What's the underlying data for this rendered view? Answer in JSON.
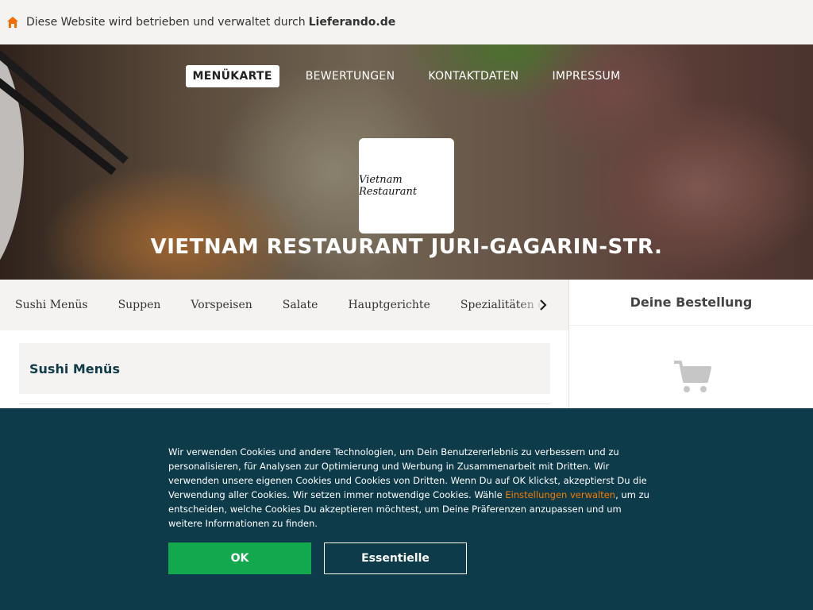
{
  "topbar": {
    "icon": "home-icon",
    "text": "Diese Website wird betrieben und verwaltet durch",
    "brand": "Lieferando.de"
  },
  "nav": {
    "items": [
      {
        "label": "MENÜKARTE",
        "active": true
      },
      {
        "label": "BEWERTUNGEN",
        "active": false
      },
      {
        "label": "KONTAKTDATEN",
        "active": false
      },
      {
        "label": "IMPRESSUM",
        "active": false
      }
    ]
  },
  "restaurant": {
    "logo_text": "Vietnam Restaurant",
    "title": "VIETNAM RESTAURANT JURI-GAGARIN-STR."
  },
  "categories": {
    "items": [
      "Sushi Menüs",
      "Suppen",
      "Vorspeisen",
      "Salate",
      "Hauptgerichte",
      "Spezialitäten de"
    ],
    "scroll_icon": "chevron-right-icon"
  },
  "menu": {
    "section_title": "Sushi Menüs"
  },
  "order": {
    "title": "Deine Bestellung",
    "icon": "cart-icon"
  },
  "cookie": {
    "text_before": "Wir verwenden Cookies und andere Technologien, um Dein Benutzererlebnis zu verbessern und zu personalisieren, für Analysen zur Optimierung und Werbung in Zusammenarbeit mit Dritten. Wir verwenden unsere eigenen Cookies und Cookies von Dritten. Wenn Du auf OK klickst, akzeptierst Du die Verwendung aller Cookies. Wir setzen immer notwendige Cookies. Wähle ",
    "link": "Einstellungen verwalten",
    "text_after": ", um zu entscheiden, welche Cookies Du akzeptieren möchtest, um Deine Präferenzen anzupassen und um weitere Informationen zu finden.",
    "ok_label": "OK",
    "essential_label": "Essentielle",
    "colors": {
      "background": "#0d3b4a",
      "ok": "#12a84e",
      "link": "#f57c00"
    }
  }
}
